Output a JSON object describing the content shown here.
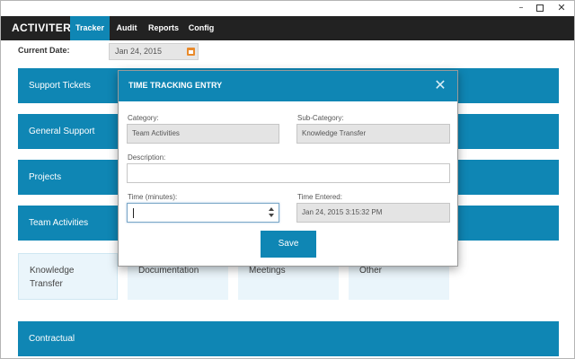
{
  "window": {
    "minimize_glyph": "–",
    "close_glyph": "✕",
    "icons": [
      "minimize-icon",
      "maximize-icon",
      "close-icon"
    ]
  },
  "navbar": {
    "brand": "ACTIVITER",
    "tabs": [
      {
        "label": "Tracker",
        "active": true
      },
      {
        "label": "Audit",
        "active": false
      },
      {
        "label": "Reports",
        "active": false
      },
      {
        "label": "Config",
        "active": false
      }
    ]
  },
  "date": {
    "label": "Current Date:",
    "value": "Jan 24, 2015",
    "icon": "calendar-icon"
  },
  "categories": [
    {
      "label": "Support Tickets"
    },
    {
      "label": "General Support"
    },
    {
      "label": "Projects"
    },
    {
      "label": "Team Activities"
    },
    {
      "label": "Contractual"
    }
  ],
  "subcategories": [
    {
      "label": "Knowledge Transfer",
      "selected": true
    },
    {
      "label": "Documentation",
      "selected": false
    },
    {
      "label": "Meetings",
      "selected": false
    },
    {
      "label": "Other",
      "selected": false
    }
  ],
  "modal": {
    "title": "TIME TRACKING ENTRY",
    "close_glyph": "✕",
    "category_label": "Category:",
    "category_value": "Team Activities",
    "subcategory_label": "Sub-Category:",
    "subcategory_value": "Knowledge Transfer",
    "description_label": "Description:",
    "description_value": "",
    "time_label": "Time (minutes):",
    "time_value": "",
    "entered_label": "Time Entered:",
    "entered_value": "Jan 24, 2015 3:15:32 PM",
    "save_label": "Save"
  },
  "colors": {
    "accent": "#0f86b4",
    "navbar": "#222222",
    "subitem_bg": "#eaf5fb",
    "readonly_bg": "#e4e4e4",
    "calendar_icon": "#e98a2b"
  }
}
